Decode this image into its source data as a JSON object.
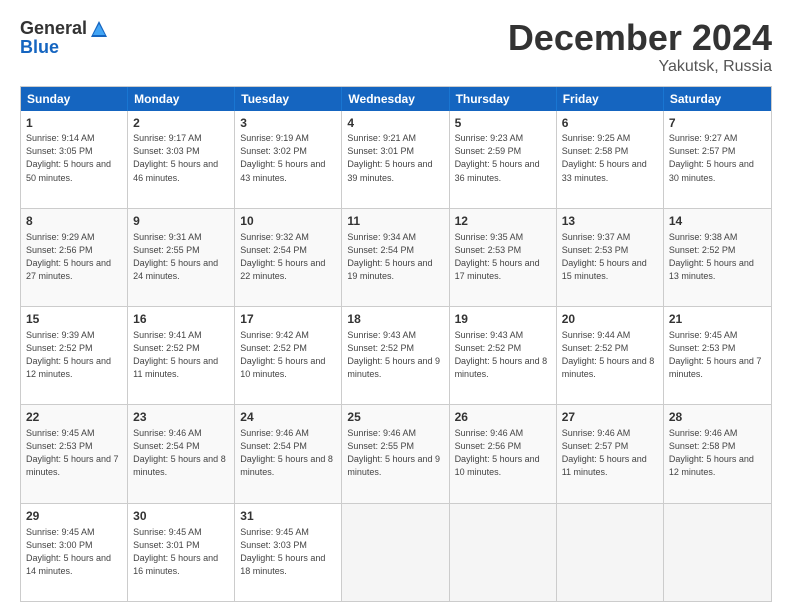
{
  "logo": {
    "general": "General",
    "blue": "Blue"
  },
  "header": {
    "month": "December 2024",
    "location": "Yakutsk, Russia"
  },
  "weekdays": [
    "Sunday",
    "Monday",
    "Tuesday",
    "Wednesday",
    "Thursday",
    "Friday",
    "Saturday"
  ],
  "rows": [
    [
      {
        "day": "1",
        "sunrise": "Sunrise: 9:14 AM",
        "sunset": "Sunset: 3:05 PM",
        "daylight": "Daylight: 5 hours and 50 minutes."
      },
      {
        "day": "2",
        "sunrise": "Sunrise: 9:17 AM",
        "sunset": "Sunset: 3:03 PM",
        "daylight": "Daylight: 5 hours and 46 minutes."
      },
      {
        "day": "3",
        "sunrise": "Sunrise: 9:19 AM",
        "sunset": "Sunset: 3:02 PM",
        "daylight": "Daylight: 5 hours and 43 minutes."
      },
      {
        "day": "4",
        "sunrise": "Sunrise: 9:21 AM",
        "sunset": "Sunset: 3:01 PM",
        "daylight": "Daylight: 5 hours and 39 minutes."
      },
      {
        "day": "5",
        "sunrise": "Sunrise: 9:23 AM",
        "sunset": "Sunset: 2:59 PM",
        "daylight": "Daylight: 5 hours and 36 minutes."
      },
      {
        "day": "6",
        "sunrise": "Sunrise: 9:25 AM",
        "sunset": "Sunset: 2:58 PM",
        "daylight": "Daylight: 5 hours and 33 minutes."
      },
      {
        "day": "7",
        "sunrise": "Sunrise: 9:27 AM",
        "sunset": "Sunset: 2:57 PM",
        "daylight": "Daylight: 5 hours and 30 minutes."
      }
    ],
    [
      {
        "day": "8",
        "sunrise": "Sunrise: 9:29 AM",
        "sunset": "Sunset: 2:56 PM",
        "daylight": "Daylight: 5 hours and 27 minutes."
      },
      {
        "day": "9",
        "sunrise": "Sunrise: 9:31 AM",
        "sunset": "Sunset: 2:55 PM",
        "daylight": "Daylight: 5 hours and 24 minutes."
      },
      {
        "day": "10",
        "sunrise": "Sunrise: 9:32 AM",
        "sunset": "Sunset: 2:54 PM",
        "daylight": "Daylight: 5 hours and 22 minutes."
      },
      {
        "day": "11",
        "sunrise": "Sunrise: 9:34 AM",
        "sunset": "Sunset: 2:54 PM",
        "daylight": "Daylight: 5 hours and 19 minutes."
      },
      {
        "day": "12",
        "sunrise": "Sunrise: 9:35 AM",
        "sunset": "Sunset: 2:53 PM",
        "daylight": "Daylight: 5 hours and 17 minutes."
      },
      {
        "day": "13",
        "sunrise": "Sunrise: 9:37 AM",
        "sunset": "Sunset: 2:53 PM",
        "daylight": "Daylight: 5 hours and 15 minutes."
      },
      {
        "day": "14",
        "sunrise": "Sunrise: 9:38 AM",
        "sunset": "Sunset: 2:52 PM",
        "daylight": "Daylight: 5 hours and 13 minutes."
      }
    ],
    [
      {
        "day": "15",
        "sunrise": "Sunrise: 9:39 AM",
        "sunset": "Sunset: 2:52 PM",
        "daylight": "Daylight: 5 hours and 12 minutes."
      },
      {
        "day": "16",
        "sunrise": "Sunrise: 9:41 AM",
        "sunset": "Sunset: 2:52 PM",
        "daylight": "Daylight: 5 hours and 11 minutes."
      },
      {
        "day": "17",
        "sunrise": "Sunrise: 9:42 AM",
        "sunset": "Sunset: 2:52 PM",
        "daylight": "Daylight: 5 hours and 10 minutes."
      },
      {
        "day": "18",
        "sunrise": "Sunrise: 9:43 AM",
        "sunset": "Sunset: 2:52 PM",
        "daylight": "Daylight: 5 hours and 9 minutes."
      },
      {
        "day": "19",
        "sunrise": "Sunrise: 9:43 AM",
        "sunset": "Sunset: 2:52 PM",
        "daylight": "Daylight: 5 hours and 8 minutes."
      },
      {
        "day": "20",
        "sunrise": "Sunrise: 9:44 AM",
        "sunset": "Sunset: 2:52 PM",
        "daylight": "Daylight: 5 hours and 8 minutes."
      },
      {
        "day": "21",
        "sunrise": "Sunrise: 9:45 AM",
        "sunset": "Sunset: 2:53 PM",
        "daylight": "Daylight: 5 hours and 7 minutes."
      }
    ],
    [
      {
        "day": "22",
        "sunrise": "Sunrise: 9:45 AM",
        "sunset": "Sunset: 2:53 PM",
        "daylight": "Daylight: 5 hours and 7 minutes."
      },
      {
        "day": "23",
        "sunrise": "Sunrise: 9:46 AM",
        "sunset": "Sunset: 2:54 PM",
        "daylight": "Daylight: 5 hours and 8 minutes."
      },
      {
        "day": "24",
        "sunrise": "Sunrise: 9:46 AM",
        "sunset": "Sunset: 2:54 PM",
        "daylight": "Daylight: 5 hours and 8 minutes."
      },
      {
        "day": "25",
        "sunrise": "Sunrise: 9:46 AM",
        "sunset": "Sunset: 2:55 PM",
        "daylight": "Daylight: 5 hours and 9 minutes."
      },
      {
        "day": "26",
        "sunrise": "Sunrise: 9:46 AM",
        "sunset": "Sunset: 2:56 PM",
        "daylight": "Daylight: 5 hours and 10 minutes."
      },
      {
        "day": "27",
        "sunrise": "Sunrise: 9:46 AM",
        "sunset": "Sunset: 2:57 PM",
        "daylight": "Daylight: 5 hours and 11 minutes."
      },
      {
        "day": "28",
        "sunrise": "Sunrise: 9:46 AM",
        "sunset": "Sunset: 2:58 PM",
        "daylight": "Daylight: 5 hours and 12 minutes."
      }
    ],
    [
      {
        "day": "29",
        "sunrise": "Sunrise: 9:45 AM",
        "sunset": "Sunset: 3:00 PM",
        "daylight": "Daylight: 5 hours and 14 minutes."
      },
      {
        "day": "30",
        "sunrise": "Sunrise: 9:45 AM",
        "sunset": "Sunset: 3:01 PM",
        "daylight": "Daylight: 5 hours and 16 minutes."
      },
      {
        "day": "31",
        "sunrise": "Sunrise: 9:45 AM",
        "sunset": "Sunset: 3:03 PM",
        "daylight": "Daylight: 5 hours and 18 minutes."
      },
      null,
      null,
      null,
      null
    ]
  ]
}
